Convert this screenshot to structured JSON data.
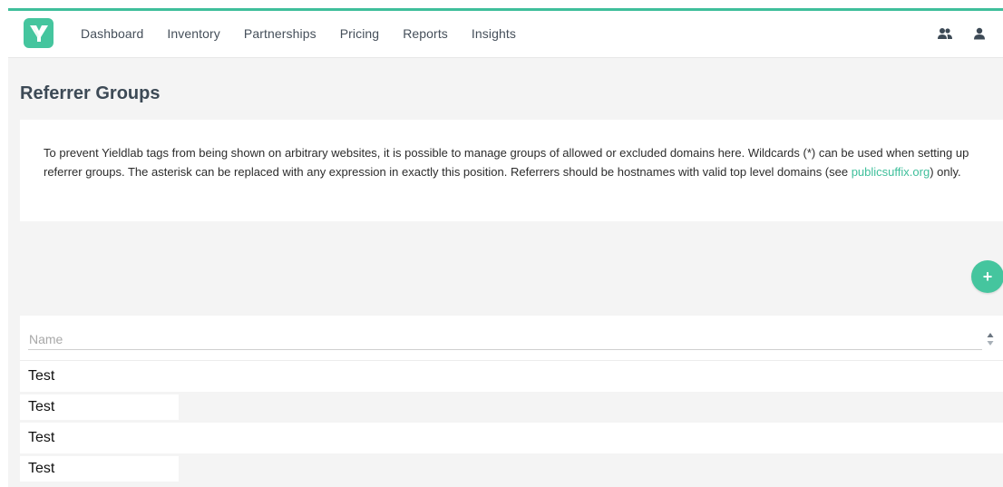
{
  "nav": {
    "items": [
      {
        "label": "Dashboard"
      },
      {
        "label": "Inventory"
      },
      {
        "label": "Partnerships"
      },
      {
        "label": "Pricing"
      },
      {
        "label": "Reports"
      },
      {
        "label": "Insights"
      }
    ]
  },
  "page": {
    "title": "Referrer Groups",
    "info_text_before_link": "To prevent Yieldlab tags from being shown on arbitrary websites, it is possible to manage groups of allowed or excluded domains here. Wildcards (*) can be used when setting up referrer groups. The asterisk can be replaced with any expression in exactly this position. Referrers should be hostnames with valid top level domains (see ",
    "info_link": "publicsuffix.org",
    "info_text_after_link": ") only.",
    "add_button_label": "+"
  },
  "table": {
    "filter_placeholder": "Name",
    "rows": [
      {
        "name": "Test"
      },
      {
        "name": "Test"
      },
      {
        "name": "Test"
      },
      {
        "name": "Test"
      }
    ]
  },
  "colors": {
    "brand": "#45c59e",
    "link": "#3fbf9b",
    "title": "#3d4a56"
  },
  "icons": {
    "logo": "yieldlab-logo-icon",
    "users": "users-icon",
    "user": "user-icon",
    "add": "plus-icon",
    "sort": "sort-arrows-icon"
  }
}
